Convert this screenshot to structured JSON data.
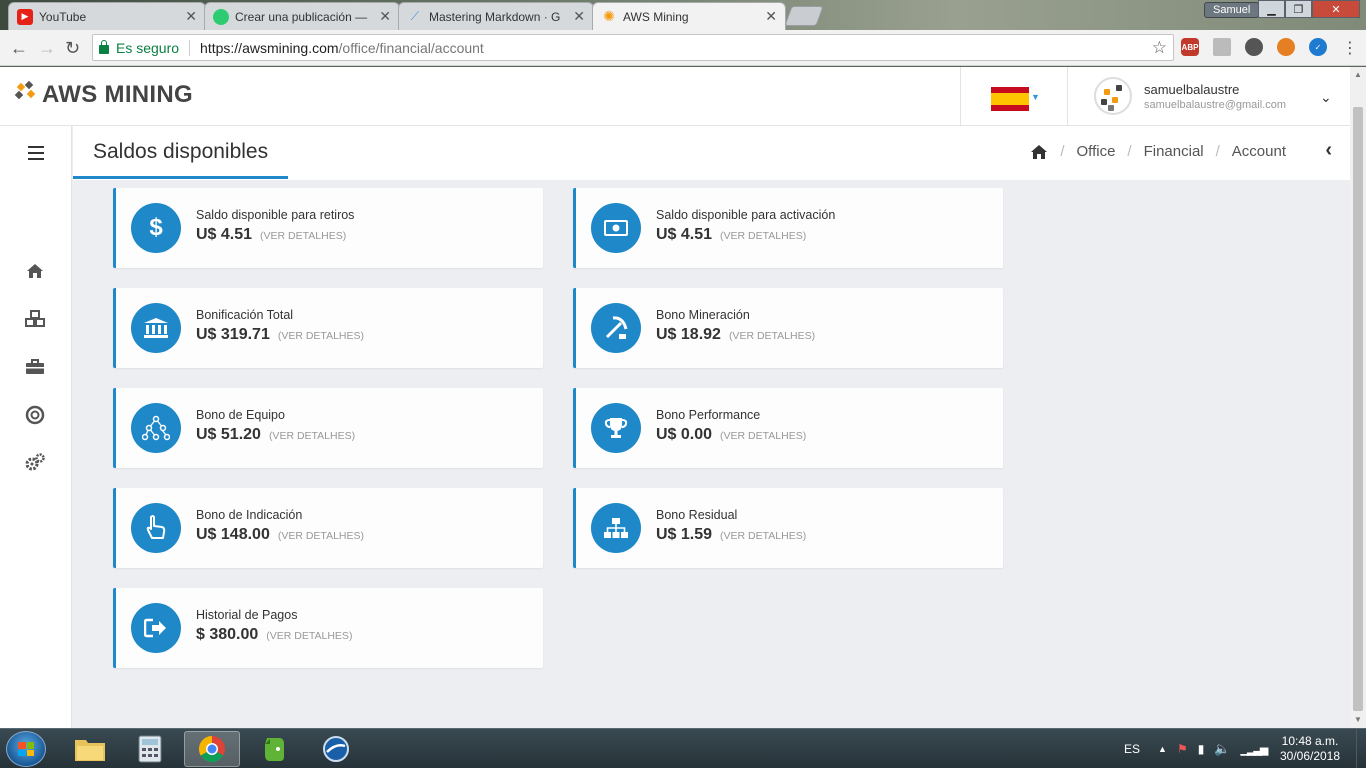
{
  "browser": {
    "tabs": [
      {
        "title": "YouTube",
        "favicon_color": "#e62117"
      },
      {
        "title": "Crear una publicación —",
        "favicon_color": "#2ecc71"
      },
      {
        "title": "Mastering Markdown · G",
        "favicon_color": "#4a90d9"
      },
      {
        "title": "AWS Mining",
        "favicon_color": "#f39c12"
      }
    ],
    "window_user": "Samuel",
    "secure_label": "Es seguro",
    "url_host": "https://awsmining.com",
    "url_path": "/office/financial/account",
    "extensions": [
      {
        "label": "ABP",
        "color": "#c0392b"
      },
      {
        "label": "",
        "color": "#aaaaaa"
      },
      {
        "label": "",
        "color": "#555555"
      },
      {
        "label": "",
        "color": "#e67e22"
      },
      {
        "label": "",
        "color": "#1e7bd0"
      }
    ]
  },
  "header": {
    "logo_text": "AWS MINING",
    "user_name": "samuelbalaustre",
    "user_email": "samuelbalaustre@gmail.com"
  },
  "page": {
    "title": "Saldos disponibles",
    "breadcrumb": [
      "Office",
      "Financial",
      "Account"
    ]
  },
  "cards": [
    {
      "label": "Saldo disponible para retiros",
      "amount": "U$ 4.51",
      "details": "(VER DETALHES)",
      "icon": "dollar-icon"
    },
    {
      "label": "Saldo disponible para activación",
      "amount": "U$ 4.51",
      "details": "(VER DETALHES)",
      "icon": "money-bill-icon"
    },
    {
      "label": "Bonificación Total",
      "amount": "U$ 319.71",
      "details": "(VER DETALHES)",
      "icon": "bank-icon"
    },
    {
      "label": "Bono Mineración",
      "amount": "U$ 18.92",
      "details": "(VER DETALHES)",
      "icon": "pickaxe-icon"
    },
    {
      "label": "Bono de Equipo",
      "amount": "U$ 51.20",
      "details": "(VER DETALHES)",
      "icon": "network-icon"
    },
    {
      "label": "Bono Performance",
      "amount": "U$ 0.00",
      "details": "(VER DETALHES)",
      "icon": "trophy-icon"
    },
    {
      "label": "Bono de Indicación",
      "amount": "U$ 148.00",
      "details": "(VER DETALHES)",
      "icon": "hand-pointer-icon"
    },
    {
      "label": "Bono Residual",
      "amount": "U$ 1.59",
      "details": "(VER DETALHES)",
      "icon": "sitemap-icon"
    },
    {
      "label": "Historial de Pagos",
      "amount": "$ 380.00",
      "details": "(VER DETALHES)",
      "icon": "sign-out-icon"
    }
  ],
  "taskbar": {
    "language": "ES",
    "time": "10:48 a.m.",
    "date": "30/06/2018"
  },
  "colors": {
    "accent": "#1e88c8",
    "page_bg": "#eceef1",
    "logo_accent": "#f39c12"
  }
}
